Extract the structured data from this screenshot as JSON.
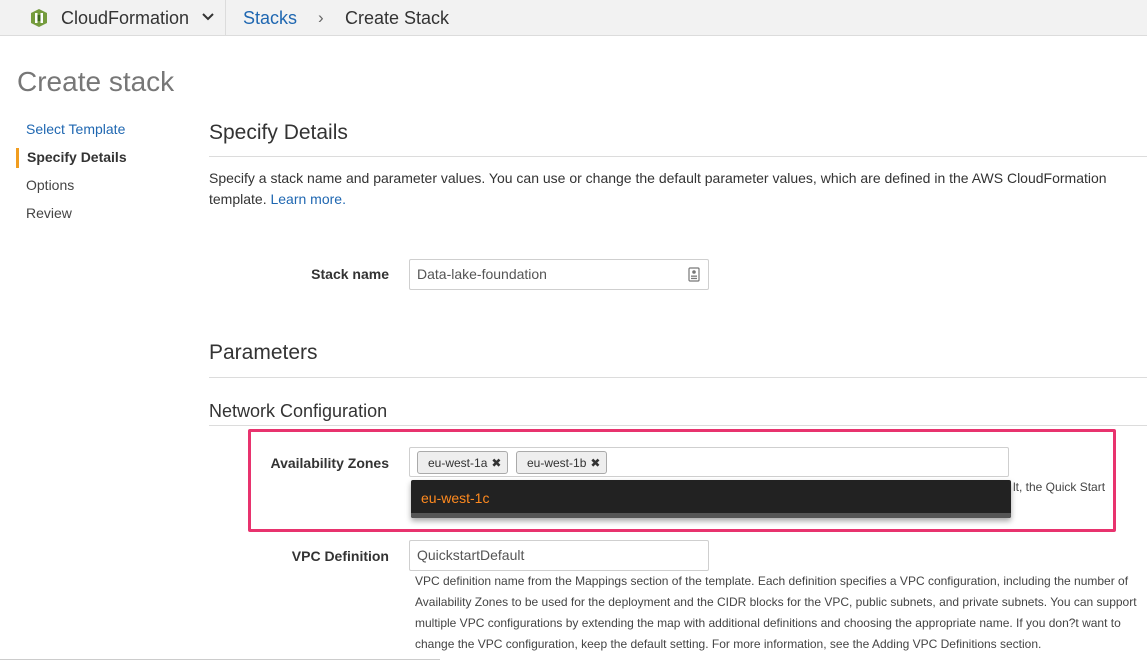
{
  "header": {
    "service": "CloudFormation",
    "breadcrumb_link": "Stacks",
    "breadcrumb_sep": "›",
    "breadcrumb_current": "Create Stack"
  },
  "page_title": "Create stack",
  "nav": {
    "items": [
      "Select Template",
      "Specify Details",
      "Options",
      "Review"
    ]
  },
  "details": {
    "heading": "Specify Details",
    "description": "Specify a stack name and parameter values. You can use or change the default parameter values, which are defined in the AWS CloudFormation template.",
    "learn_more": "Learn more."
  },
  "stack_name": {
    "label": "Stack name",
    "value": "Data-lake-foundation"
  },
  "parameters": {
    "heading": "Parameters",
    "group": "Network Configuration"
  },
  "availability_zones": {
    "label": "Availability Zones",
    "selected": [
      "eu-west-1a",
      "eu-west-1b"
    ],
    "dropdown_option": "eu-west-1c",
    "help_fragment": "lt, the Quick Start"
  },
  "vpc_definition": {
    "label": "VPC Definition",
    "value": "QuickstartDefault",
    "help": "VPC definition name from the Mappings section of the template. Each definition specifies a VPC configuration, including the number of Availability Zones to be used for the deployment and the CIDR blocks for the VPC, public subnets, and private subnets. You can support multiple VPC configurations by extending the map with additional definitions and choosing the appropriate name. If you don?t want to change the VPC configuration, keep the default setting. For more information, see the Adding VPC Definitions section."
  },
  "colors": {
    "accent_link": "#1f67b1",
    "highlight": "#e8336e",
    "nav_active_bar": "#f19d1f",
    "dropdown_text": "#ff8a1f"
  }
}
